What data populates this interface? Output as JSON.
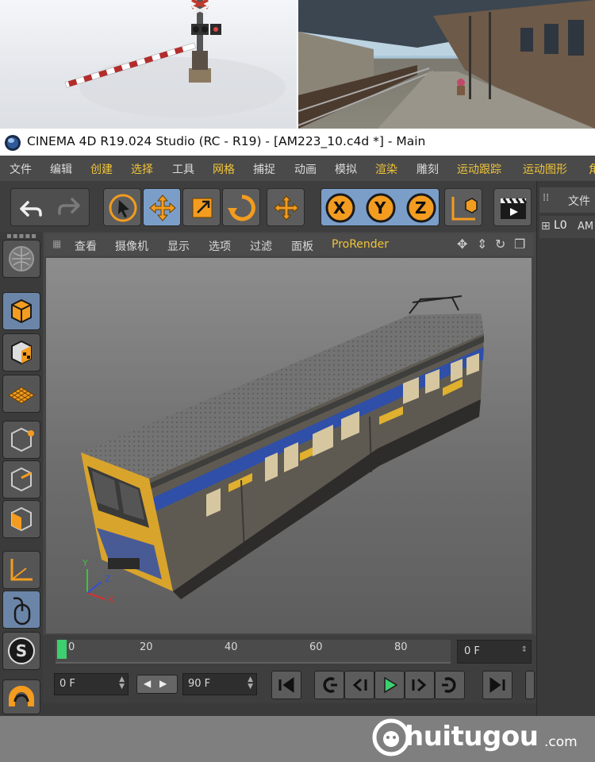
{
  "window": {
    "title": "CINEMA 4D R19.024 Studio (RC - R19) - [AM223_10.c4d *] - Main"
  },
  "menu": [
    {
      "label": "文件",
      "highlight": false
    },
    {
      "label": "编辑",
      "highlight": false
    },
    {
      "label": "创建",
      "highlight": true
    },
    {
      "label": "选择",
      "highlight": true
    },
    {
      "label": "工具",
      "highlight": false
    },
    {
      "label": "网格",
      "highlight": true
    },
    {
      "label": "捕捉",
      "highlight": false
    },
    {
      "label": "动画",
      "highlight": false
    },
    {
      "label": "模拟",
      "highlight": false
    },
    {
      "label": "渲染",
      "highlight": true
    },
    {
      "label": "雕刻",
      "highlight": false
    },
    {
      "label": "运动跟踪",
      "highlight": true
    },
    {
      "label": "运动图形",
      "highlight": true
    },
    {
      "label": "角",
      "highlight": true
    }
  ],
  "toolbar": {
    "undo": "undo-icon",
    "redo": "redo-icon",
    "axis_x": "X",
    "axis_y": "Y",
    "axis_z": "Z"
  },
  "viewport_menu": [
    {
      "label": "查看",
      "highlight": false
    },
    {
      "label": "摄像机",
      "highlight": false
    },
    {
      "label": "显示",
      "highlight": false
    },
    {
      "label": "选项",
      "highlight": false
    },
    {
      "label": "过滤",
      "highlight": false
    },
    {
      "label": "面板",
      "highlight": false
    },
    {
      "label": "ProRender",
      "highlight": true
    }
  ],
  "axes_gizmo": {
    "x": "X",
    "y": "Y",
    "z": "Z"
  },
  "timeline": {
    "ticks": [
      "0",
      "20",
      "40",
      "60",
      "80"
    ],
    "current_frame": "0 F"
  },
  "transport": {
    "start_frame": "0 F",
    "end_frame": "90 F"
  },
  "right_panel": {
    "tab": "文件",
    "object_label": "L0",
    "object_name": "AM"
  },
  "footer": {
    "brand": "huitugou",
    "domain": ".com"
  },
  "colors": {
    "accent_gold": "#f0c43a",
    "icon_orange": "#f39c1f",
    "active_blue": "#7b9ec9"
  }
}
